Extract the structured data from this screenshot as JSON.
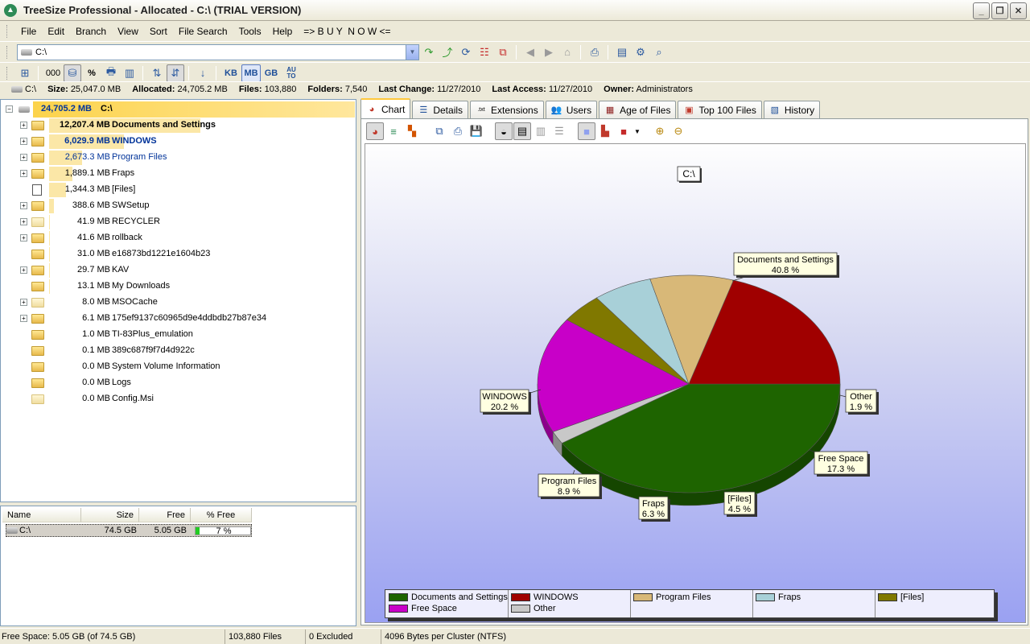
{
  "window": {
    "title": "TreeSize Professional - Allocated - C:\\  (TRIAL VERSION)",
    "min": "_",
    "max": "❐",
    "close": "✕"
  },
  "menu": [
    "File",
    "Edit",
    "Branch",
    "View",
    "Sort",
    "File Search",
    "Tools",
    "Help",
    "=> B U Y  N O W <="
  ],
  "address": {
    "value": "C:\\"
  },
  "units": {
    "kb": "KB",
    "mb": "MB",
    "gb": "GB",
    "auto": "AU\nTO",
    "thousands": "000",
    "percent": "%"
  },
  "info": {
    "drive": "C:\\",
    "size_label": "Size:",
    "size": "25,047.0 MB",
    "allocated_label": "Allocated:",
    "allocated": "24,705.2 MB",
    "files_label": "Files:",
    "files": "103,880",
    "folders_label": "Folders:",
    "folders": "7,540",
    "last_change_label": "Last Change:",
    "last_change": "11/27/2010",
    "last_access_label": "Last Access:",
    "last_access": "11/27/2010",
    "owner_label": "Owner:",
    "owner": "Administrators"
  },
  "tree": {
    "root": {
      "size": "24,705.2 MB",
      "name": "C:\\"
    },
    "items": [
      {
        "size": "12,207.4 MB",
        "name": "Documents and Settings",
        "pct": 49.4,
        "style": "bold",
        "icon": "folder-icon",
        "expand": true
      },
      {
        "size": "6,029.9 MB",
        "name": "WINDOWS",
        "pct": 24.4,
        "style": "boldblue",
        "icon": "folder-icon",
        "expand": true
      },
      {
        "size": "2,673.3 MB",
        "name": "Program Files",
        "pct": 10.8,
        "style": "blue",
        "icon": "folder-icon",
        "expand": true
      },
      {
        "size": "1,889.1 MB",
        "name": "Fraps",
        "pct": 7.6,
        "style": "",
        "icon": "folder-icon",
        "expand": true
      },
      {
        "size": "1,344.3 MB",
        "name": "[Files]",
        "pct": 5.4,
        "style": "",
        "icon": "file-icon",
        "expand": false
      },
      {
        "size": "388.6 MB",
        "name": "SWSetup",
        "pct": 1.6,
        "style": "",
        "icon": "folder-icon",
        "expand": true
      },
      {
        "size": "41.9 MB",
        "name": "RECYCLER",
        "pct": 0.2,
        "style": "",
        "icon": "folder-light-icon",
        "expand": true
      },
      {
        "size": "41.6 MB",
        "name": "rollback",
        "pct": 0.2,
        "style": "",
        "icon": "folder-icon",
        "expand": true
      },
      {
        "size": "31.0 MB",
        "name": "e16873bd1221e1604b23",
        "pct": 0.1,
        "style": "",
        "icon": "folder-icon",
        "expand": false
      },
      {
        "size": "29.7 MB",
        "name": "KAV",
        "pct": 0.1,
        "style": "",
        "icon": "folder-icon",
        "expand": true
      },
      {
        "size": "13.1 MB",
        "name": "My Downloads",
        "pct": 0.1,
        "style": "",
        "icon": "folder-icon",
        "expand": false
      },
      {
        "size": "8.0 MB",
        "name": "MSOCache",
        "pct": 0,
        "style": "",
        "icon": "folder-light-icon",
        "expand": true
      },
      {
        "size": "6.1 MB",
        "name": "175ef9137c60965d9e4ddbdb27b87e34",
        "pct": 0,
        "style": "",
        "icon": "folder-icon",
        "expand": true
      },
      {
        "size": "1.0 MB",
        "name": "TI-83Plus_emulation",
        "pct": 0,
        "style": "",
        "icon": "folder-icon",
        "expand": false
      },
      {
        "size": "0.1 MB",
        "name": "389c687f9f7d4d922c",
        "pct": 0,
        "style": "",
        "icon": "folder-icon",
        "expand": false
      },
      {
        "size": "0.0 MB",
        "name": "System Volume Information",
        "pct": 0,
        "style": "",
        "icon": "folder-icon",
        "expand": false
      },
      {
        "size": "0.0 MB",
        "name": "Logs",
        "pct": 0,
        "style": "",
        "icon": "folder-icon",
        "expand": false
      },
      {
        "size": "0.0 MB",
        "name": "Config.Msi",
        "pct": 0,
        "style": "",
        "icon": "folder-light-icon",
        "expand": false
      }
    ]
  },
  "drives": {
    "headers": [
      "Name",
      "Size",
      "Free",
      "% Free"
    ],
    "rows": [
      {
        "name": "C:\\",
        "size": "74.5 GB",
        "free": "5.05 GB",
        "pct_free": "7 %",
        "pct_value": 7
      }
    ]
  },
  "tabs": [
    {
      "label": "Chart",
      "icon": "pie-icon",
      "active": true
    },
    {
      "label": "Details",
      "icon": "details-icon"
    },
    {
      "label": "Extensions",
      "icon": "extensions-icon"
    },
    {
      "label": "Users",
      "icon": "users-icon"
    },
    {
      "label": "Age of Files",
      "icon": "calendar-icon"
    },
    {
      "label": "Top 100 Files",
      "icon": "top-files-icon"
    },
    {
      "label": "History",
      "icon": "history-icon"
    }
  ],
  "chart_data": {
    "type": "pie",
    "title": "C:\\",
    "slices": [
      {
        "label": "Documents and Settings",
        "pct_label": "40.8 %",
        "value": 40.8,
        "color": "#1e6400"
      },
      {
        "label": "Other",
        "pct_label": "1.9 %",
        "value": 1.9,
        "color": "#c8c8c8"
      },
      {
        "label": "Free Space",
        "pct_label": "17.3 %",
        "value": 17.3,
        "color": "#c800c8"
      },
      {
        "label": "[Files]",
        "pct_label": "4.5 %",
        "value": 4.5,
        "color": "#807800"
      },
      {
        "label": "Fraps",
        "pct_label": "6.3 %",
        "value": 6.3,
        "color": "#a8d0d8"
      },
      {
        "label": "Program Files",
        "pct_label": "8.9 %",
        "value": 8.9,
        "color": "#d8b878"
      },
      {
        "label": "WINDOWS",
        "pct_label": "20.2 %",
        "value": 20.2,
        "color": "#a00000"
      }
    ],
    "legend": [
      "Documents and Settings",
      "WINDOWS",
      "Program Files",
      "Fraps",
      "[Files]",
      "Free Space",
      "Other"
    ]
  },
  "status": {
    "free_space": "Free Space: 5.05 GB  (of 74.5 GB)",
    "files": "103,880  Files",
    "excluded": "0 Excluded",
    "cluster": "4096 Bytes per Cluster (NTFS)"
  }
}
